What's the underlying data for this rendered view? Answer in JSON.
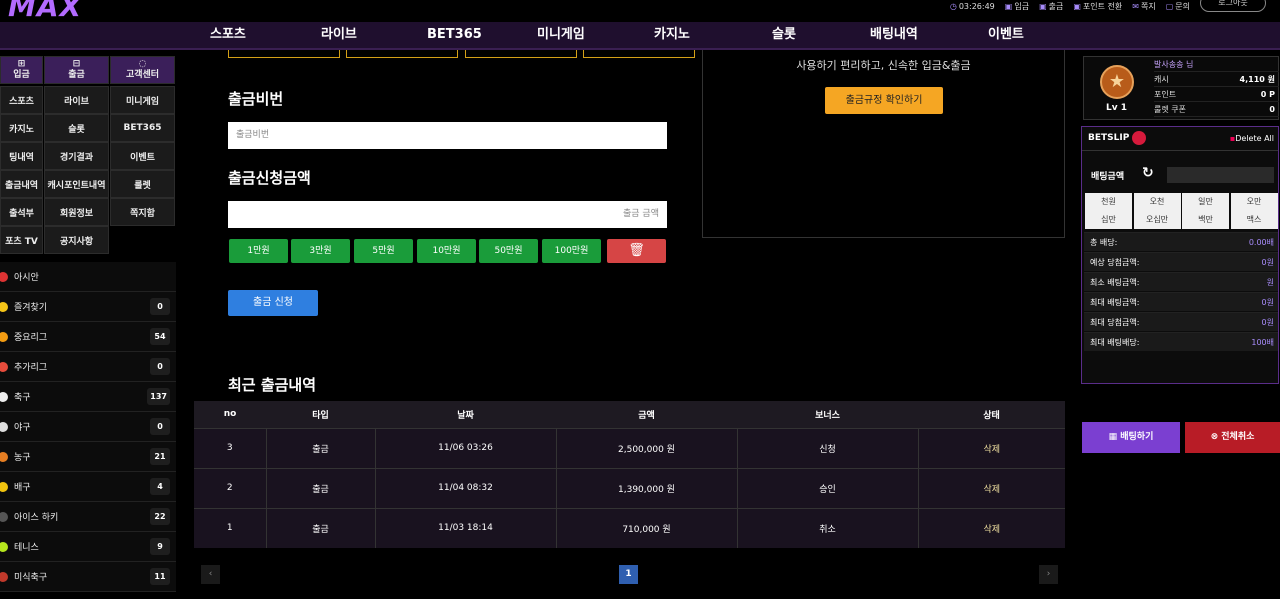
{
  "header": {
    "logo": "MAX",
    "time": "03:26:49",
    "links": [
      "입금",
      "출금",
      "포인트 전환",
      "쪽지",
      "문의"
    ],
    "logout": "로그아웃"
  },
  "nav": [
    "스포츠",
    "라이브",
    "BET365",
    "미니게임",
    "카지노",
    "슬롯",
    "배팅내역",
    "이벤트"
  ],
  "left": {
    "top_buttons": [
      "입금",
      "출금",
      "고객센터"
    ],
    "menu": [
      "스포츠",
      "라이브",
      "미니게임",
      "카지노",
      "슬롯",
      "BET365",
      "팅내역",
      "경기결과",
      "이벤트",
      "출금내역",
      "캐시포인트내역",
      "룰렛",
      "출석부",
      "회원정보",
      "쪽지함",
      "포츠 TV",
      "공지사항"
    ],
    "sports": [
      {
        "name": "아시안",
        "count": "",
        "color": "#d33"
      },
      {
        "name": "즐겨찾기",
        "count": "0",
        "color": "#f5c518"
      },
      {
        "name": "중요리그",
        "count": "54",
        "color": "#f39c12"
      },
      {
        "name": "추가리그",
        "count": "0",
        "color": "#e74c3c"
      },
      {
        "name": "축구",
        "count": "137",
        "color": "#eee"
      },
      {
        "name": "야구",
        "count": "0",
        "color": "#ddd"
      },
      {
        "name": "농구",
        "count": "21",
        "color": "#e67e22"
      },
      {
        "name": "배구",
        "count": "4",
        "color": "#f1c40f"
      },
      {
        "name": "아이스 하키",
        "count": "22",
        "color": "#555"
      },
      {
        "name": "테니스",
        "count": "9",
        "color": "#b5e61d"
      },
      {
        "name": "미식축구",
        "count": "11",
        "color": "#c0392b"
      }
    ]
  },
  "main": {
    "pw_title": "출금비번",
    "pw_placeholder": "출금비번",
    "amount_title": "출금신청금액",
    "amount_placeholder": "출금 금액",
    "amount_buttons": [
      "1만원",
      "3만원",
      "5만원",
      "10만원",
      "50만원",
      "100만원"
    ],
    "submit": "출금 신청",
    "notice": "사용하기 편리하고, 신속한 입금&출금",
    "notice_button": "출금규정 확인하기",
    "history_title": "최근 출금내역",
    "table_headers": [
      "no",
      "타입",
      "날짜",
      "금액",
      "보너스",
      "상태"
    ],
    "rows": [
      {
        "no": "3",
        "type": "출금",
        "date": "11/06 03:26",
        "amount": "2,500,000 원",
        "bonus": "신청",
        "status": "삭제"
      },
      {
        "no": "2",
        "type": "출금",
        "date": "11/04 08:32",
        "amount": "1,390,000 원",
        "bonus": "승인",
        "status": "삭제"
      },
      {
        "no": "1",
        "type": "출금",
        "date": "11/03 18:14",
        "amount": "710,000 원",
        "bonus": "취소",
        "status": "삭제"
      }
    ],
    "page": "1"
  },
  "profile": {
    "username": "발사송송 님",
    "level": "Lv 1",
    "cash_label": "캐시",
    "cash": "4,110 원",
    "point_label": "포인트",
    "point": "0 P",
    "coupon_label": "룰렛 쿠폰",
    "coupon": "0"
  },
  "betslip": {
    "title": "BETSLIP",
    "delete_all": "Delete All",
    "amount_label": "배팅금액",
    "quick": [
      "천원",
      "오천",
      "일만",
      "오만",
      "십만",
      "오십만",
      "백만",
      "맥스"
    ],
    "rows": [
      {
        "label": "총 배당:",
        "value": "0.00배"
      },
      {
        "label": "예상 당첨금액:",
        "value": "0원"
      },
      {
        "label": "최소 배팅금액:",
        "value": "원"
      },
      {
        "label": "최대 배팅금액:",
        "value": "0원"
      },
      {
        "label": "최대 당첨금액:",
        "value": "0원"
      },
      {
        "label": "최대 배팅배당:",
        "value": "100배"
      }
    ],
    "bet_button": "배팅하기",
    "cancel_button": "전체취소"
  }
}
